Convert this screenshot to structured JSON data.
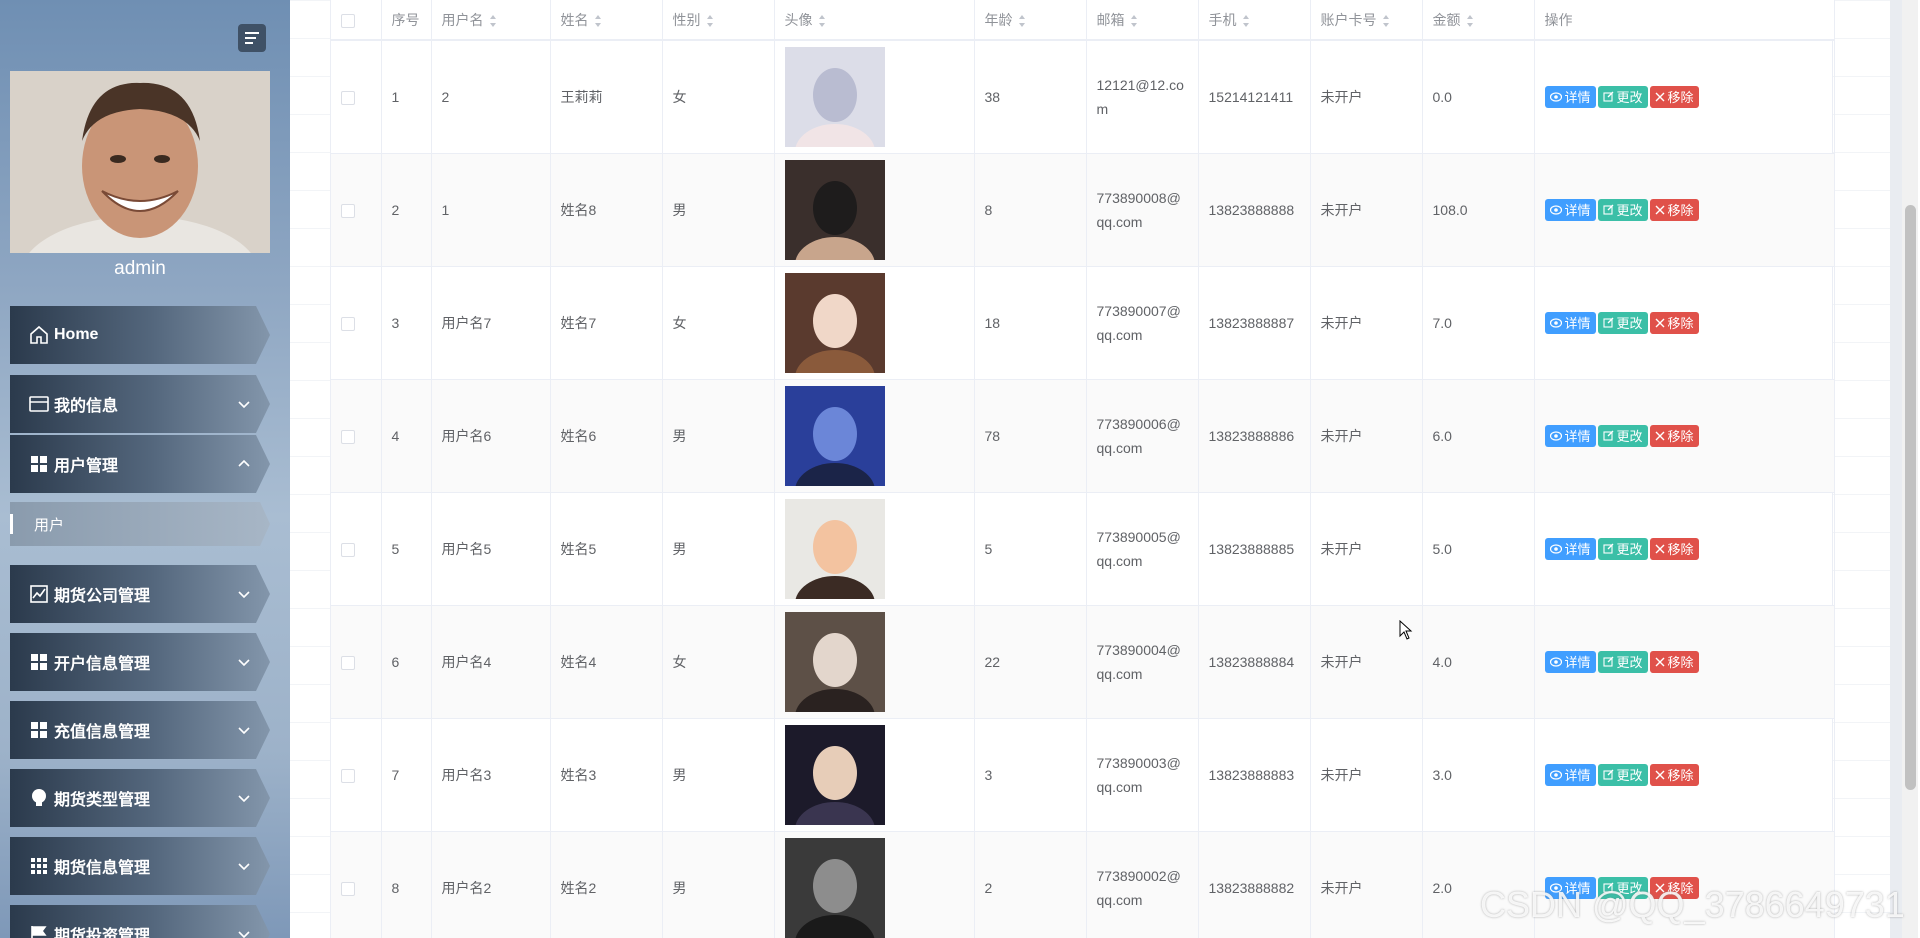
{
  "sidebar": {
    "user_name": "admin",
    "menu": [
      {
        "label": "Home",
        "icon": "home-icon",
        "expanded": null
      },
      {
        "label": "我的信息",
        "icon": "card-icon",
        "expanded": false
      },
      {
        "label": "用户管理",
        "icon": "grid-icon",
        "expanded": true
      },
      {
        "label": "期货公司管理",
        "icon": "chart-icon",
        "expanded": false
      },
      {
        "label": "开户信息管理",
        "icon": "grid-icon",
        "expanded": false
      },
      {
        "label": "充值信息管理",
        "icon": "grid-icon",
        "expanded": false
      },
      {
        "label": "期货类型管理",
        "icon": "bulb-icon",
        "expanded": false
      },
      {
        "label": "期货信息管理",
        "icon": "apps-icon",
        "expanded": false
      },
      {
        "label": "期货投资管理",
        "icon": "flag-icon",
        "expanded": false
      }
    ],
    "submenu": {
      "label": "用户"
    }
  },
  "table": {
    "headers": [
      "序号",
      "用户名",
      "姓名",
      "性别",
      "头像",
      "年龄",
      "邮箱",
      "手机",
      "账户卡号",
      "金额",
      "操作"
    ],
    "rows": [
      {
        "index": "1",
        "username": "2",
        "name": "王莉莉",
        "gender": "女",
        "age": "38",
        "email": "12121@12.com",
        "phone": "15214121411",
        "card": "未开户",
        "amount": "0.0"
      },
      {
        "index": "2",
        "username": "1",
        "name": "姓名8",
        "gender": "男",
        "age": "8",
        "email": "773890008@qq.com",
        "phone": "13823888888",
        "card": "未开户",
        "amount": "108.0"
      },
      {
        "index": "3",
        "username": "用户名7",
        "name": "姓名7",
        "gender": "女",
        "age": "18",
        "email": "773890007@qq.com",
        "phone": "13823888887",
        "card": "未开户",
        "amount": "7.0"
      },
      {
        "index": "4",
        "username": "用户名6",
        "name": "姓名6",
        "gender": "男",
        "age": "78",
        "email": "773890006@qq.com",
        "phone": "13823888886",
        "card": "未开户",
        "amount": "6.0"
      },
      {
        "index": "5",
        "username": "用户名5",
        "name": "姓名5",
        "gender": "男",
        "age": "5",
        "email": "773890005@qq.com",
        "phone": "13823888885",
        "card": "未开户",
        "amount": "5.0"
      },
      {
        "index": "6",
        "username": "用户名4",
        "name": "姓名4",
        "gender": "女",
        "age": "22",
        "email": "773890004@qq.com",
        "phone": "13823888884",
        "card": "未开户",
        "amount": "4.0"
      },
      {
        "index": "7",
        "username": "用户名3",
        "name": "姓名3",
        "gender": "男",
        "age": "3",
        "email": "773890003@qq.com",
        "phone": "13823888883",
        "card": "未开户",
        "amount": "3.0"
      },
      {
        "index": "8",
        "username": "用户名2",
        "name": "姓名2",
        "gender": "男",
        "age": "2",
        "email": "773890002@qq.com",
        "phone": "13823888882",
        "card": "未开户",
        "amount": "2.0"
      }
    ],
    "actions": {
      "detail": "详情",
      "edit": "更改",
      "remove": "移除"
    }
  },
  "watermark": "CSDN @QQ_3786649731",
  "colors": {
    "detail": "#409eff",
    "edit": "#3bbfa7",
    "remove": "#e0514a",
    "menu_dark": "#2b3a4c"
  }
}
